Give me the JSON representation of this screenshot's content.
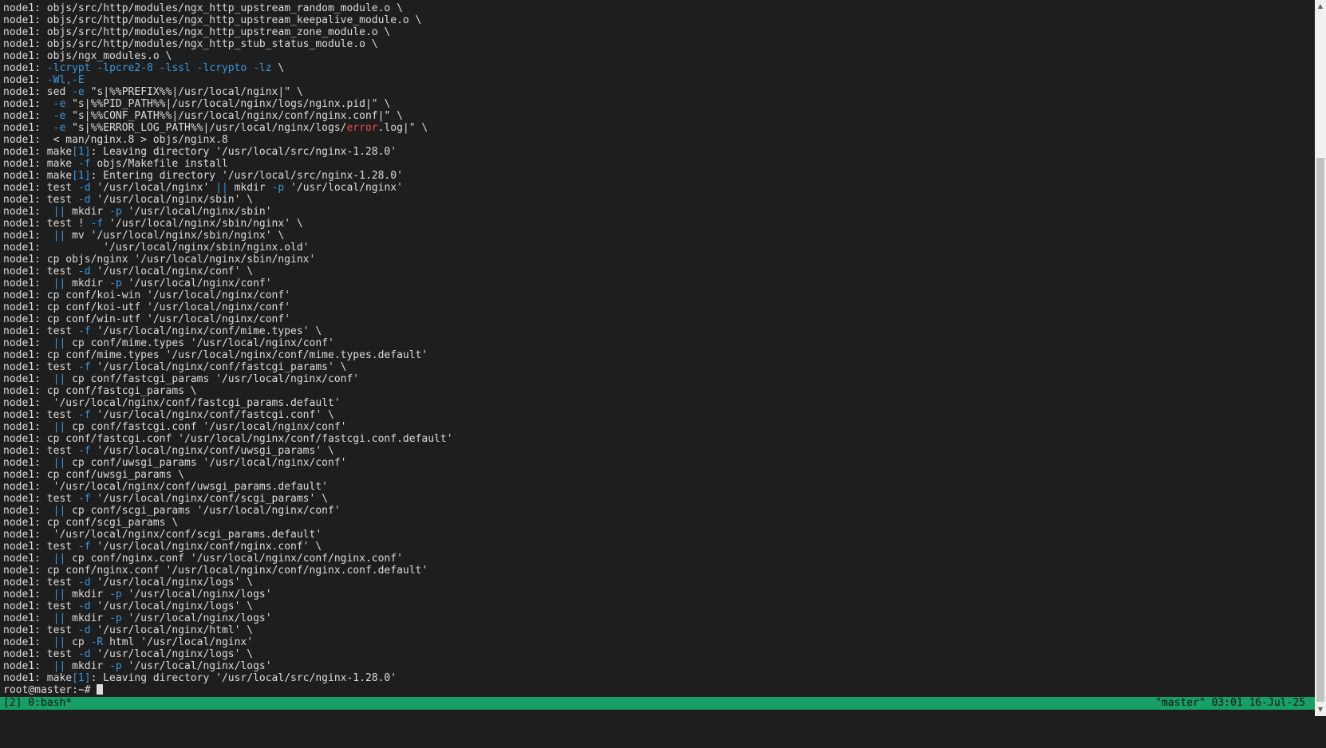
{
  "terminal": {
    "lines": [
      [
        [
          "c",
          "node1: objs/src/http/modules/ngx_http_upstream_random_module.o \\"
        ]
      ],
      [
        [
          "c",
          "node1: objs/src/http/modules/ngx_http_upstream_keepalive_module.o \\"
        ]
      ],
      [
        [
          "c",
          "node1: objs/src/http/modules/ngx_http_upstream_zone_module.o \\"
        ]
      ],
      [
        [
          "c",
          "node1: objs/src/http/modules/ngx_http_stub_status_module.o \\"
        ]
      ],
      [
        [
          "c",
          "node1: objs/ngx_modules.o \\"
        ]
      ],
      [
        [
          "c",
          "node1: "
        ],
        [
          "f",
          "-lcrypt -lpcre2-8 -lssl -lcrypto -lz"
        ],
        [
          "c",
          " \\"
        ]
      ],
      [
        [
          "c",
          "node1: "
        ],
        [
          "f",
          "-Wl,-E"
        ]
      ],
      [
        [
          "c",
          "node1: sed "
        ],
        [
          "f",
          "-e"
        ],
        [
          "c",
          " \"s|%%PREFIX%%|/usr/local/nginx|\" \\"
        ]
      ],
      [
        [
          "c",
          "node1:  "
        ],
        [
          "f",
          "-e"
        ],
        [
          "c",
          " \"s|%%PID_PATH%%|/usr/local/nginx/logs/nginx.pid|\" \\"
        ]
      ],
      [
        [
          "c",
          "node1:  "
        ],
        [
          "f",
          "-e"
        ],
        [
          "c",
          " \"s|%%CONF_PATH%%|/usr/local/nginx/conf/nginx.conf|\" \\"
        ]
      ],
      [
        [
          "c",
          "node1:  "
        ],
        [
          "f",
          "-e"
        ],
        [
          "c",
          " \"s|%%ERROR_LOG_PATH%%|/usr/local/nginx/logs/"
        ],
        [
          "r",
          "error"
        ],
        [
          "c",
          ".log|\" \\"
        ]
      ],
      [
        [
          "c",
          "node1:  < man/nginx.8 > objs/nginx.8"
        ]
      ],
      [
        [
          "c",
          "node1: make"
        ],
        [
          "f",
          "[1]"
        ],
        [
          "c",
          ": Leaving directory '/usr/local/src/nginx-1.28.0'"
        ]
      ],
      [
        [
          "c",
          "node1: make "
        ],
        [
          "f",
          "-f"
        ],
        [
          "c",
          " objs/Makefile install"
        ]
      ],
      [
        [
          "c",
          "node1: make"
        ],
        [
          "f",
          "[1]"
        ],
        [
          "c",
          ": Entering directory '/usr/local/src/nginx-1.28.0'"
        ]
      ],
      [
        [
          "c",
          "node1: test "
        ],
        [
          "f",
          "-d"
        ],
        [
          "c",
          " '/usr/local/nginx' "
        ],
        [
          "f",
          "||"
        ],
        [
          "c",
          " mkdir "
        ],
        [
          "f",
          "-p"
        ],
        [
          "c",
          " '/usr/local/nginx'"
        ]
      ],
      [
        [
          "c",
          "node1: test "
        ],
        [
          "f",
          "-d"
        ],
        [
          "c",
          " '/usr/local/nginx/sbin' \\"
        ]
      ],
      [
        [
          "c",
          "node1:  "
        ],
        [
          "f",
          "||"
        ],
        [
          "c",
          " mkdir "
        ],
        [
          "f",
          "-p"
        ],
        [
          "c",
          " '/usr/local/nginx/sbin'"
        ]
      ],
      [
        [
          "c",
          "node1: test ! "
        ],
        [
          "f",
          "-f"
        ],
        [
          "c",
          " '/usr/local/nginx/sbin/nginx' \\"
        ]
      ],
      [
        [
          "c",
          "node1:  "
        ],
        [
          "f",
          "||"
        ],
        [
          "c",
          " mv '/usr/local/nginx/sbin/nginx' \\"
        ]
      ],
      [
        [
          "c",
          "node1:          '/usr/local/nginx/sbin/nginx.old'"
        ]
      ],
      [
        [
          "c",
          "node1: cp objs/nginx '/usr/local/nginx/sbin/nginx'"
        ]
      ],
      [
        [
          "c",
          "node1: test "
        ],
        [
          "f",
          "-d"
        ],
        [
          "c",
          " '/usr/local/nginx/conf' \\"
        ]
      ],
      [
        [
          "c",
          "node1:  "
        ],
        [
          "f",
          "||"
        ],
        [
          "c",
          " mkdir "
        ],
        [
          "f",
          "-p"
        ],
        [
          "c",
          " '/usr/local/nginx/conf'"
        ]
      ],
      [
        [
          "c",
          "node1: cp conf/koi-win '/usr/local/nginx/conf'"
        ]
      ],
      [
        [
          "c",
          "node1: cp conf/koi-utf '/usr/local/nginx/conf'"
        ]
      ],
      [
        [
          "c",
          "node1: cp conf/win-utf '/usr/local/nginx/conf'"
        ]
      ],
      [
        [
          "c",
          "node1: test "
        ],
        [
          "f",
          "-f"
        ],
        [
          "c",
          " '/usr/local/nginx/conf/mime.types' \\"
        ]
      ],
      [
        [
          "c",
          "node1:  "
        ],
        [
          "f",
          "||"
        ],
        [
          "c",
          " cp conf/mime.types '/usr/local/nginx/conf'"
        ]
      ],
      [
        [
          "c",
          "node1: cp conf/mime.types '/usr/local/nginx/conf/mime.types.default'"
        ]
      ],
      [
        [
          "c",
          "node1: test "
        ],
        [
          "f",
          "-f"
        ],
        [
          "c",
          " '/usr/local/nginx/conf/fastcgi_params' \\"
        ]
      ],
      [
        [
          "c",
          "node1:  "
        ],
        [
          "f",
          "||"
        ],
        [
          "c",
          " cp conf/fastcgi_params '/usr/local/nginx/conf'"
        ]
      ],
      [
        [
          "c",
          "node1: cp conf/fastcgi_params \\"
        ]
      ],
      [
        [
          "c",
          "node1:  '/usr/local/nginx/conf/fastcgi_params.default'"
        ]
      ],
      [
        [
          "c",
          "node1: test "
        ],
        [
          "f",
          "-f"
        ],
        [
          "c",
          " '/usr/local/nginx/conf/fastcgi.conf' \\"
        ]
      ],
      [
        [
          "c",
          "node1:  "
        ],
        [
          "f",
          "||"
        ],
        [
          "c",
          " cp conf/fastcgi.conf '/usr/local/nginx/conf'"
        ]
      ],
      [
        [
          "c",
          "node1: cp conf/fastcgi.conf '/usr/local/nginx/conf/fastcgi.conf.default'"
        ]
      ],
      [
        [
          "c",
          "node1: test "
        ],
        [
          "f",
          "-f"
        ],
        [
          "c",
          " '/usr/local/nginx/conf/uwsgi_params' \\"
        ]
      ],
      [
        [
          "c",
          "node1:  "
        ],
        [
          "f",
          "||"
        ],
        [
          "c",
          " cp conf/uwsgi_params '/usr/local/nginx/conf'"
        ]
      ],
      [
        [
          "c",
          "node1: cp conf/uwsgi_params \\"
        ]
      ],
      [
        [
          "c",
          "node1:  '/usr/local/nginx/conf/uwsgi_params.default'"
        ]
      ],
      [
        [
          "c",
          "node1: test "
        ],
        [
          "f",
          "-f"
        ],
        [
          "c",
          " '/usr/local/nginx/conf/scgi_params' \\"
        ]
      ],
      [
        [
          "c",
          "node1:  "
        ],
        [
          "f",
          "||"
        ],
        [
          "c",
          " cp conf/scgi_params '/usr/local/nginx/conf'"
        ]
      ],
      [
        [
          "c",
          "node1: cp conf/scgi_params \\"
        ]
      ],
      [
        [
          "c",
          "node1:  '/usr/local/nginx/conf/scgi_params.default'"
        ]
      ],
      [
        [
          "c",
          "node1: test "
        ],
        [
          "f",
          "-f"
        ],
        [
          "c",
          " '/usr/local/nginx/conf/nginx.conf' \\"
        ]
      ],
      [
        [
          "c",
          "node1:  "
        ],
        [
          "f",
          "||"
        ],
        [
          "c",
          " cp conf/nginx.conf '/usr/local/nginx/conf/nginx.conf'"
        ]
      ],
      [
        [
          "c",
          "node1: cp conf/nginx.conf '/usr/local/nginx/conf/nginx.conf.default'"
        ]
      ],
      [
        [
          "c",
          "node1: test "
        ],
        [
          "f",
          "-d"
        ],
        [
          "c",
          " '/usr/local/nginx/logs' \\"
        ]
      ],
      [
        [
          "c",
          "node1:  "
        ],
        [
          "f",
          "||"
        ],
        [
          "c",
          " mkdir "
        ],
        [
          "f",
          "-p"
        ],
        [
          "c",
          " '/usr/local/nginx/logs'"
        ]
      ],
      [
        [
          "c",
          "node1: test "
        ],
        [
          "f",
          "-d"
        ],
        [
          "c",
          " '/usr/local/nginx/logs' \\"
        ]
      ],
      [
        [
          "c",
          "node1:  "
        ],
        [
          "f",
          "||"
        ],
        [
          "c",
          " mkdir "
        ],
        [
          "f",
          "-p"
        ],
        [
          "c",
          " '/usr/local/nginx/logs'"
        ]
      ],
      [
        [
          "c",
          "node1: test "
        ],
        [
          "f",
          "-d"
        ],
        [
          "c",
          " '/usr/local/nginx/html' \\"
        ]
      ],
      [
        [
          "c",
          "node1:  "
        ],
        [
          "f",
          "||"
        ],
        [
          "c",
          " cp "
        ],
        [
          "f",
          "-R"
        ],
        [
          "c",
          " html '/usr/local/nginx'"
        ]
      ],
      [
        [
          "c",
          "node1: test "
        ],
        [
          "f",
          "-d"
        ],
        [
          "c",
          " '/usr/local/nginx/logs' \\"
        ]
      ],
      [
        [
          "c",
          "node1:  "
        ],
        [
          "f",
          "||"
        ],
        [
          "c",
          " mkdir "
        ],
        [
          "f",
          "-p"
        ],
        [
          "c",
          " '/usr/local/nginx/logs'"
        ]
      ],
      [
        [
          "c",
          "node1: make"
        ],
        [
          "f",
          "[1]"
        ],
        [
          "c",
          ": Leaving directory '/usr/local/src/nginx-1.28.0'"
        ]
      ]
    ],
    "prompt": "root@master:~# "
  },
  "statusbar": {
    "left": "[2] 0:bash*",
    "right": "\"master\" 03:01 16-Jul-25"
  },
  "scrollbar": {
    "up_arrow": "▲",
    "down_arrow": "▼",
    "position_fraction": 1.0
  },
  "colors": {
    "background": "#1e1e1e",
    "foreground": "#dcdcdc",
    "flag_blue": "#3a96dd",
    "error_red": "#e74856",
    "status_green": "#16a065"
  }
}
